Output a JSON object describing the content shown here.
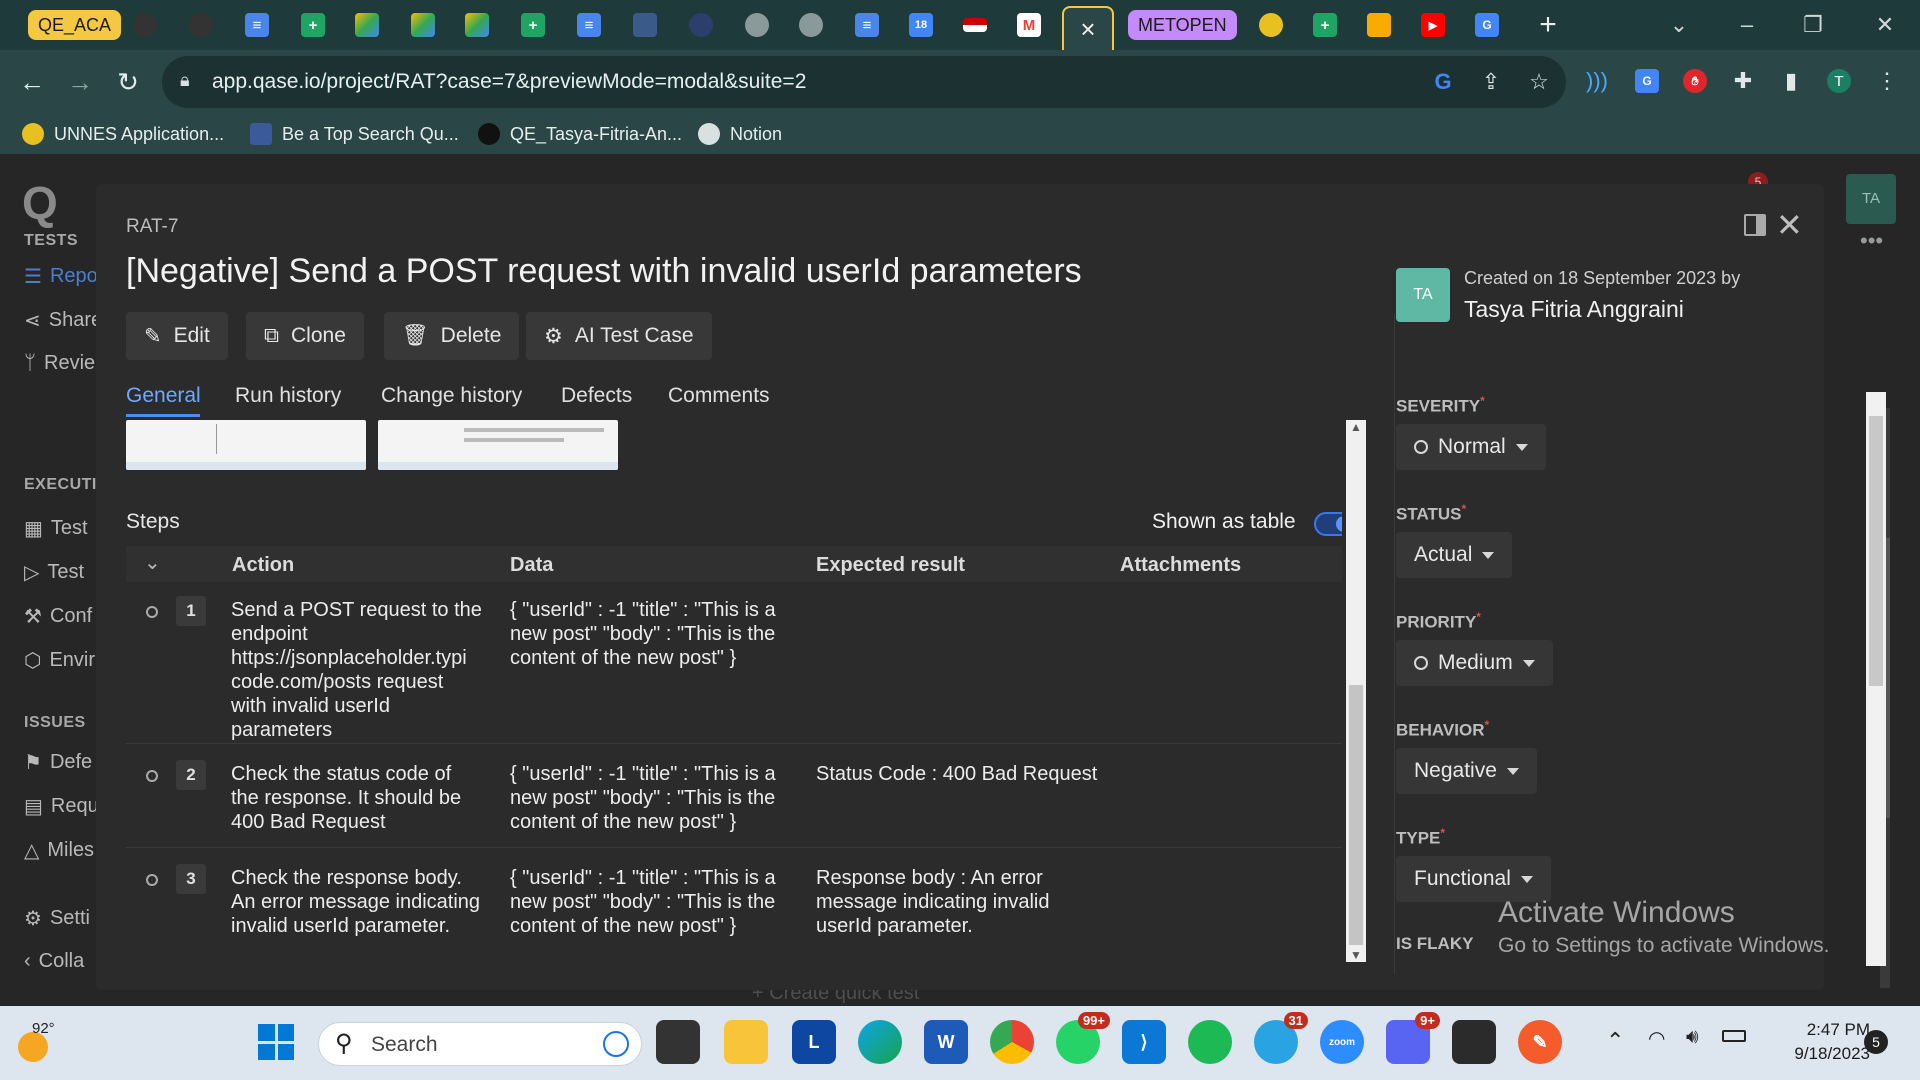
{
  "browser": {
    "tab_groups": [
      {
        "label": "QE_ACA",
        "color": "#f5c842"
      },
      {
        "label": "METOPEN",
        "color": "#c58af9"
      }
    ],
    "active_tab_close": "×",
    "url": "app.qase.io/project/RAT?case=7&previewMode=modal&suite=2",
    "profile_initial": "T",
    "bookmarks": [
      {
        "label": "UNNES Application..."
      },
      {
        "label": "Be a Top Search Qu..."
      },
      {
        "label": "QE_Tasya-Fitria-An..."
      },
      {
        "label": "Notion"
      }
    ]
  },
  "sidebar": {
    "logo": "Q",
    "section_tests": "TESTS",
    "tests_items": [
      "Repo",
      "Share",
      "Revie"
    ],
    "section_execution": "EXECUTI",
    "execution_items": [
      "Test",
      "Test",
      "Conf",
      "Envir"
    ],
    "section_issues": "ISSUES",
    "issues_items": [
      "Defe",
      "Requ",
      "Miles"
    ],
    "settings": "Setti",
    "collapse": "Colla",
    "create_quick_test": "+ Create quick test",
    "notif_count": "5",
    "user_initials": "TA"
  },
  "modal": {
    "case_id": "RAT-7",
    "title": "[Negative] Send a POST request with invalid userId parameters",
    "actions": [
      {
        "label": "Edit",
        "icon": "pencil-icon"
      },
      {
        "label": "Clone",
        "icon": "clone-icon"
      },
      {
        "label": "Delete",
        "icon": "trash-icon"
      },
      {
        "label": "AI Test Case",
        "icon": "ai-icon"
      }
    ],
    "tabs": [
      "General",
      "Run history",
      "Change history",
      "Defects",
      "Comments"
    ],
    "active_tab": "General",
    "steps_label": "Steps",
    "shown_as_table_label": "Shown as table",
    "shown_as_table_on": true,
    "table_headers": {
      "action": "Action",
      "data": "Data",
      "expected": "Expected result",
      "attachments": "Attachments"
    },
    "steps": [
      {
        "number": "1",
        "action_lines": [
          "Send a POST request to the",
          "endpoint",
          "https://jsonplaceholder.typi",
          "code.com/posts request",
          "with invalid userId",
          "parameters"
        ],
        "data_lines": [
          "{ \"userId\" : -1 \"title\" : \"This is a",
          "new post\" \"body\" : \"This is the",
          "content of the new post\" }"
        ],
        "expected_lines": []
      },
      {
        "number": "2",
        "action_lines": [
          "Check the status code of",
          "the response. It should be",
          "400 Bad Request"
        ],
        "data_lines": [
          "{ \"userId\" : -1 \"title\" : \"This is a",
          "new post\" \"body\" : \"This is the",
          "content of the new post\" }"
        ],
        "expected_lines": [
          "Status Code : 400 Bad Request"
        ]
      },
      {
        "number": "3",
        "action_lines": [
          "Check the response body.",
          "An error message indicating",
          "invalid userId parameter."
        ],
        "data_lines": [
          "{ \"userId\" : -1 \"title\" : \"This is a",
          "new post\" \"body\" : \"This is the",
          "content of the new post\" }"
        ],
        "expected_lines": [
          "Response body : An error",
          "message indicating invalid",
          "userId parameter."
        ]
      }
    ],
    "meta": {
      "avatar_initials": "TA",
      "created_text": "Created on 18 September 2023 by",
      "author": "Tasya Fitria Anggraini",
      "fields": [
        {
          "label": "SEVERITY",
          "value": "Normal",
          "ring": true
        },
        {
          "label": "STATUS",
          "value": "Actual",
          "ring": false
        },
        {
          "label": "PRIORITY",
          "value": "Medium",
          "ring": true
        },
        {
          "label": "BEHAVIOR",
          "value": "Negative",
          "ring": false
        },
        {
          "label": "TYPE",
          "value": "Functional",
          "ring": false
        }
      ],
      "is_flaky_label": "IS FLAKY"
    }
  },
  "watermark": {
    "line1": "Activate Windows",
    "line2": "Go to Settings to activate Windows."
  },
  "taskbar": {
    "weather_temp": "92°",
    "search_placeholder": "Search",
    "whatsapp_badge": "99+",
    "telegram_badge": "31",
    "discord_badge": "9+",
    "time": "2:47 PM",
    "date": "9/18/2023",
    "notification_count": "5"
  }
}
